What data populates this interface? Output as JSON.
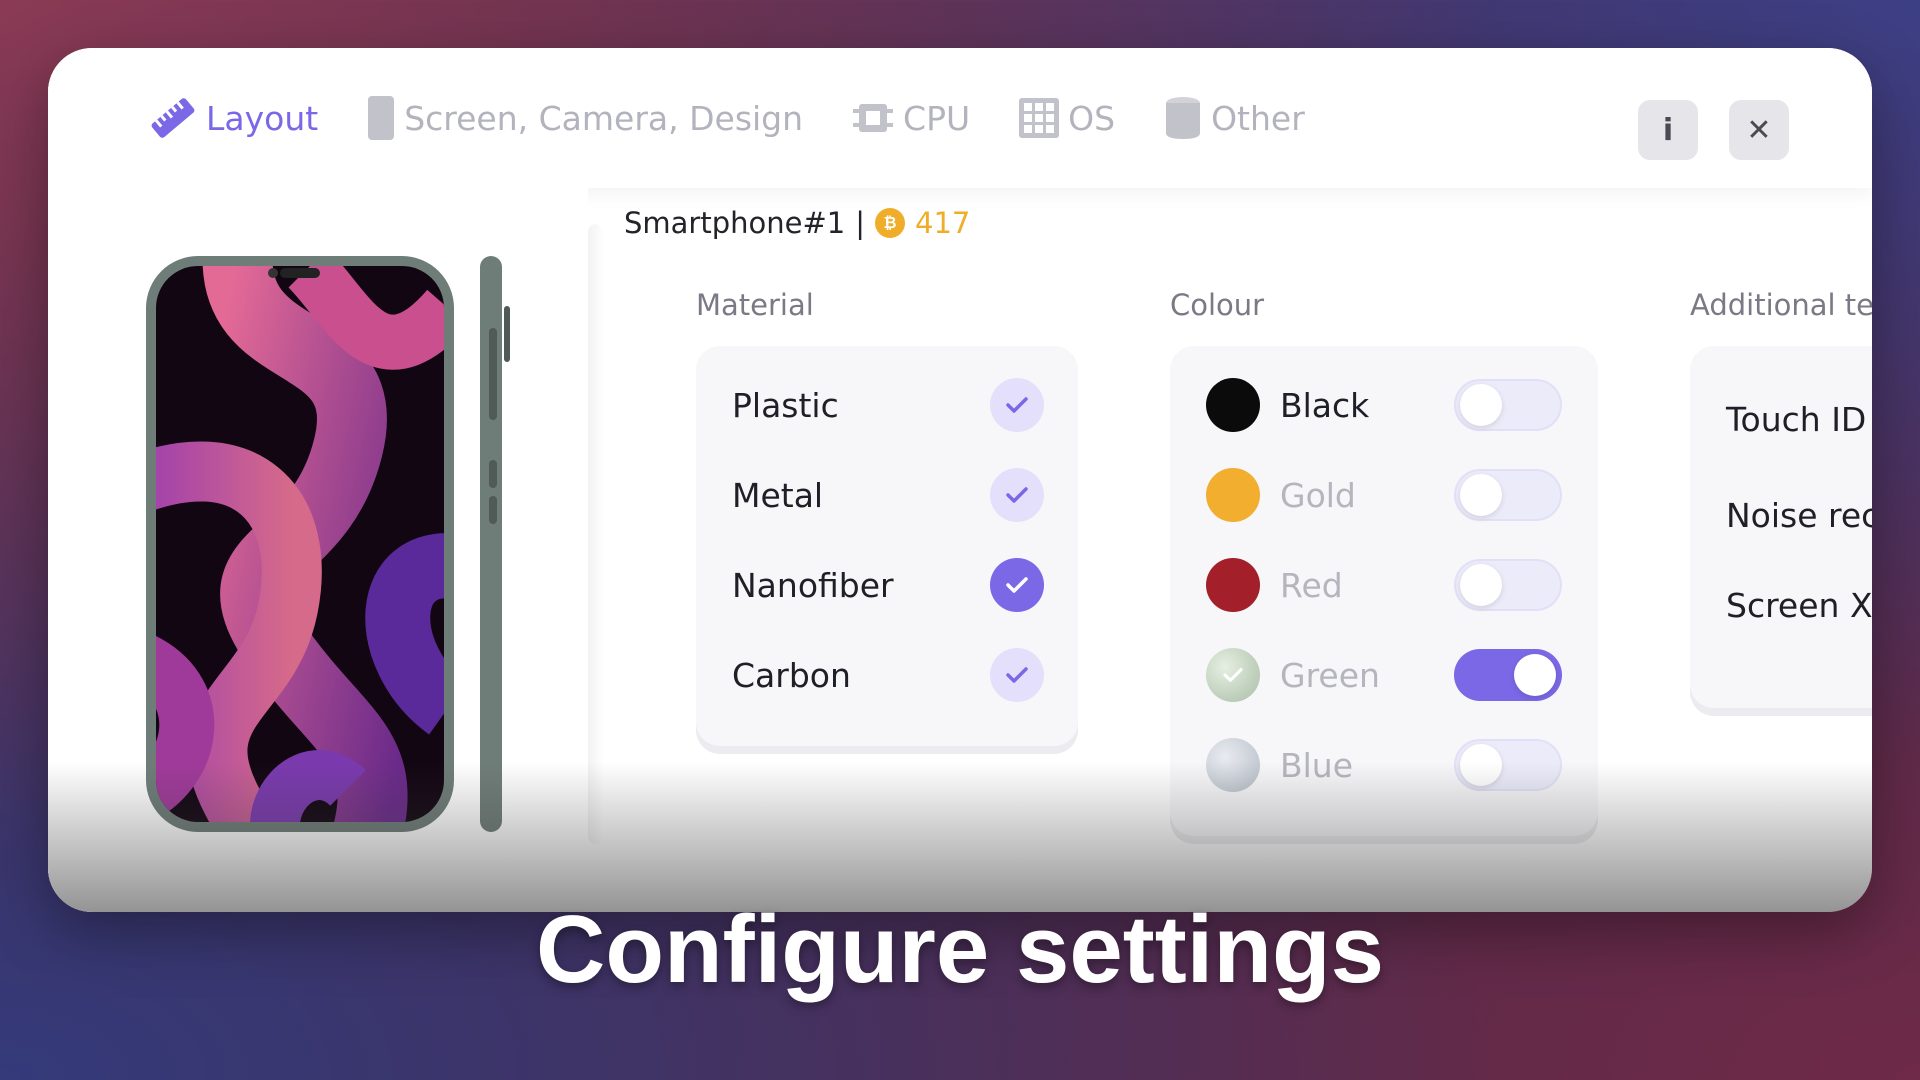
{
  "tabs": [
    {
      "label": "Layout",
      "icon": "ruler-icon",
      "active": true
    },
    {
      "label": "Screen, Camera, Design",
      "icon": "phone-icon",
      "active": false
    },
    {
      "label": "CPU",
      "icon": "chip-icon",
      "active": false
    },
    {
      "label": "OS",
      "icon": "grid-icon",
      "active": false
    },
    {
      "label": "Other",
      "icon": "cup-icon",
      "active": false
    }
  ],
  "header": {
    "info_label": "i",
    "close_label": "✕"
  },
  "breadcrumb": {
    "name": "Smartphone#1",
    "separator": "|",
    "coin_symbol": "₿",
    "coins": "417"
  },
  "material": {
    "title": "Material",
    "items": [
      {
        "label": "Plastic",
        "selected": false
      },
      {
        "label": "Metal",
        "selected": false
      },
      {
        "label": "Nanofiber",
        "selected": true
      },
      {
        "label": "Carbon",
        "selected": false
      }
    ]
  },
  "colour": {
    "title": "Colour",
    "items": [
      {
        "label": "Black",
        "color": "#0b0b0b",
        "on": false,
        "dim": false
      },
      {
        "label": "Gold",
        "color": "#f2ae2e",
        "on": false,
        "dim": true
      },
      {
        "label": "Red",
        "color": "#a3202a",
        "on": false,
        "dim": true
      },
      {
        "label": "Green",
        "color": "#c7d6c4",
        "on": true,
        "dim": true
      },
      {
        "label": "Blue",
        "color": "#c9ced6",
        "on": false,
        "dim": true
      }
    ]
  },
  "additional": {
    "title": "Additional te",
    "items": [
      {
        "label": "Touch ID"
      },
      {
        "label": "Noise rec"
      },
      {
        "label": "Screen X"
      }
    ]
  },
  "caption": "Configure settings",
  "colors": {
    "accent": "#7a68e6",
    "coin": "#f0ad2a",
    "phone_frame": "#6f7d78"
  }
}
